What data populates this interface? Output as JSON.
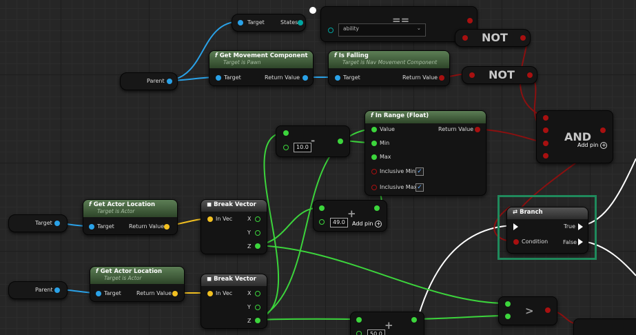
{
  "colors": {
    "exec": "#ffffff",
    "object": "#2aa2e8",
    "vector": "#f2c021",
    "float": "#3cd53c",
    "bool": "#a81010",
    "byte": "#00a6a2",
    "selection": "#1f8a5c"
  },
  "nodes": {
    "enum_compare": {
      "target_label": "Target",
      "states_label": "States",
      "op": "==",
      "dropdown_value": "ability",
      "dropdown_icon": "chevron-down-icon"
    },
    "not1": {
      "label": "NOT"
    },
    "not2": {
      "label": "NOT"
    },
    "parent_top": {
      "label": "Parent"
    },
    "get_movement": {
      "title": "Get Movement Component",
      "subtitle": "Target is Pawn",
      "target": "Target",
      "return": "Return Value"
    },
    "is_falling": {
      "title": "Is Falling",
      "subtitle": "Target is Nav Movement Component",
      "target": "Target",
      "return": "Return Value"
    },
    "subtract": {
      "op": "-",
      "value": "10.0"
    },
    "in_range": {
      "title": "In Range (Float)",
      "value": "Value",
      "min": "Min",
      "max": "Max",
      "inclusive_min": "Inclusive Min",
      "inclusive_max": "Inclusive Max",
      "return": "Return Value"
    },
    "and": {
      "label": "AND",
      "add_pin": "Add pin"
    },
    "target_var": {
      "label": "Target"
    },
    "get_actor_location_1": {
      "title": "Get Actor Location",
      "subtitle": "Target is Actor",
      "target": "Target",
      "return": "Return Value"
    },
    "break_vector_1": {
      "title": "Break Vector",
      "in": "In Vec",
      "x": "X",
      "y": "Y",
      "z": "Z"
    },
    "add": {
      "op": "+",
      "value": "49.0",
      "add_pin": "Add pin"
    },
    "branch": {
      "title": "Branch",
      "condition": "Condition",
      "true_label": "True",
      "false_label": "False"
    },
    "parent_bottom": {
      "label": "Parent"
    },
    "get_actor_location_2": {
      "title": "Get Actor Location",
      "subtitle": "Target is Actor",
      "target": "Target",
      "return": "Return Value"
    },
    "break_vector_2": {
      "title": "Break Vector",
      "in": "In Vec",
      "x": "X",
      "y": "Y",
      "z": "Z"
    },
    "greater": {
      "op": ">"
    },
    "add_bottom": {
      "op": "+",
      "value": "50.0"
    }
  }
}
